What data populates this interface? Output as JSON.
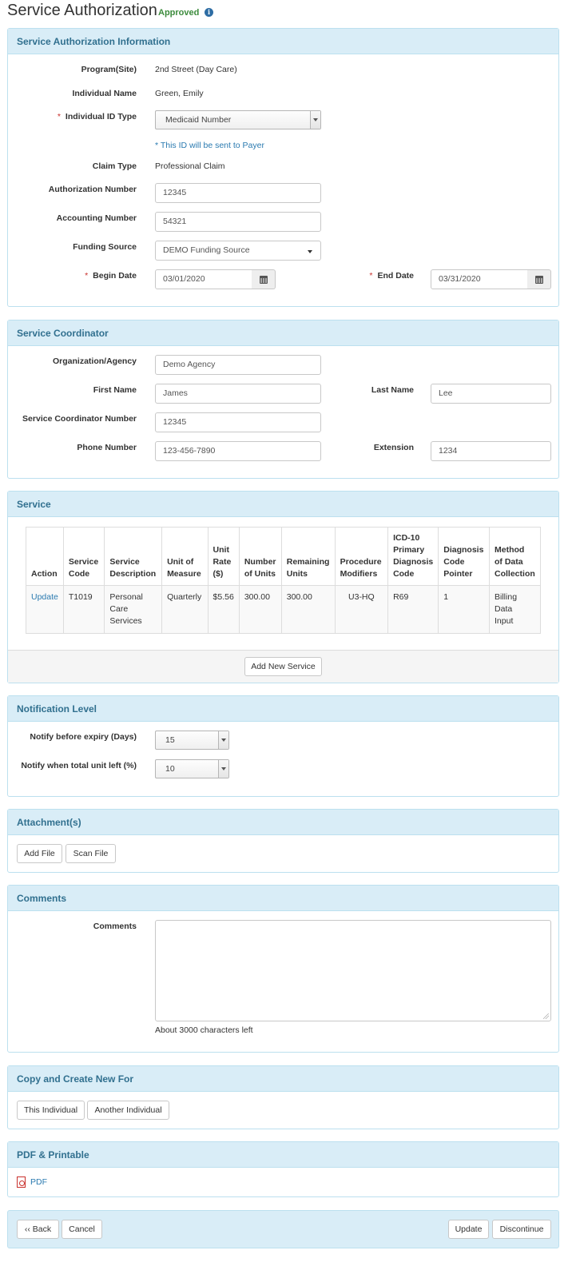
{
  "header": {
    "title": "Service Authorization",
    "status": "Approved",
    "info_icon": "i"
  },
  "auth_info": {
    "heading": "Service Authorization Information",
    "program_label": "Program(Site)",
    "program_value": "2nd Street (Day Care)",
    "individual_name_label": "Individual Name",
    "individual_name_value": "Green, Emily",
    "id_type_label": "Individual ID Type",
    "id_type_value": "Medicaid Number",
    "id_note": "* This ID will be sent to Payer",
    "claim_type_label": "Claim Type",
    "claim_type_value": "Professional Claim",
    "auth_number_label": "Authorization Number",
    "auth_number_value": "12345",
    "accounting_number_label": "Accounting Number",
    "accounting_number_value": "54321",
    "funding_source_label": "Funding Source",
    "funding_source_value": "DEMO Funding Source",
    "begin_date_label": "Begin Date",
    "begin_date_value": "03/01/2020",
    "end_date_label": "End Date",
    "end_date_value": "03/31/2020",
    "required_mark": "*"
  },
  "coordinator": {
    "heading": "Service Coordinator",
    "org_label": "Organization/Agency",
    "org_value": "Demo Agency",
    "first_name_label": "First Name",
    "first_name_value": "James",
    "last_name_label": "Last Name",
    "last_name_value": "Lee",
    "number_label": "Service Coordinator Number",
    "number_value": "12345",
    "phone_label": "Phone Number",
    "phone_value": "123-456-7890",
    "extension_label": "Extension",
    "extension_value": "1234"
  },
  "service": {
    "heading": "Service",
    "columns": [
      [
        "Action"
      ],
      [
        "Service",
        "Code"
      ],
      [
        "Service",
        "Description"
      ],
      [
        "Unit of",
        "Measure"
      ],
      [
        "Unit",
        "Rate",
        "($)"
      ],
      [
        "Number",
        "of Units"
      ],
      [
        "Remaining",
        "Units"
      ],
      [
        "Procedure",
        "Modifiers"
      ],
      [
        "ICD-10",
        "Primary",
        "Diagnosis",
        "Code"
      ],
      [
        "Diagnosis",
        "Code",
        "Pointer"
      ],
      [
        "Method",
        "of Data",
        "Collection"
      ]
    ],
    "rows": [
      {
        "action": "Update",
        "code": "T1019",
        "description": [
          "Personal",
          "Care",
          "Services"
        ],
        "unit_measure": "Quarterly",
        "unit_rate": "$5.56",
        "number_units": "300.00",
        "remaining_units": "300.00",
        "modifiers": "U3-HQ",
        "icd10": "R69",
        "pointer": "1",
        "method": [
          "Billing Data",
          "Input"
        ]
      }
    ],
    "add_button": "Add New Service"
  },
  "notification": {
    "heading": "Notification Level",
    "expiry_label": "Notify before expiry (Days)",
    "expiry_value": "15",
    "unit_left_label": "Notify when total unit left (%)",
    "unit_left_value": "10"
  },
  "attachments": {
    "heading": "Attachment(s)",
    "add_file": "Add File",
    "scan_file": "Scan File"
  },
  "comments": {
    "heading": "Comments",
    "label": "Comments",
    "value": "",
    "chars_left": "About 3000 characters left"
  },
  "copy": {
    "heading": "Copy and Create New For",
    "this_individual": "This Individual",
    "another_individual": "Another Individual"
  },
  "pdf": {
    "heading": "PDF & Printable",
    "link": "PDF"
  },
  "footer": {
    "back": "‹‹ Back",
    "cancel": "Cancel",
    "update": "Update",
    "discontinue": "Discontinue"
  },
  "colors": {
    "panel_heading_bg": "#d9edf7",
    "panel_heading_text": "#31708f",
    "approved": "#3c8b3c",
    "link": "#2a7ab0",
    "required": "#c9302c"
  }
}
